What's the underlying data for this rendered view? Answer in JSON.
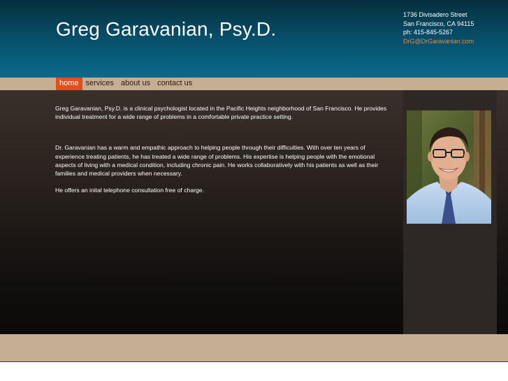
{
  "header": {
    "title": "Greg Garavanian, Psy.D.",
    "contact": {
      "street": "1736 Divisadero Street",
      "city": "San Francisco, CA 94115",
      "phone": "ph: 415-845-5267",
      "email": "DrG@DrGaravanian.com"
    }
  },
  "nav": {
    "items": [
      {
        "label": "home",
        "active": true
      },
      {
        "label": "services",
        "active": false
      },
      {
        "label": "about us",
        "active": false
      },
      {
        "label": "contact us",
        "active": false
      }
    ]
  },
  "main": {
    "paragraphs": [
      "Greg Garavanian, Psy.D. is a clinical psychologist located in the Pacific Heights neighborhood of San Francisco.  He provides individual treatment for a wide range of problems in a comfortable private practice setting.",
      "Dr. Garavanian has a warm and empathic approach to helping people through their difficulties.  With over ten years of experience treating patients, he has treated a wide range of problems.  His expertise is helping people with the emotional aspects of living with a medical condition, including chronic pain.  He works collaboratively with his patients as well as their families and medical providers when necessary.",
      "He offers an inital telephone consultation free of charge."
    ]
  },
  "colors": {
    "header_top": "#062e3c",
    "header_bottom": "#0a6a8c",
    "nav_bg": "#c6ae93",
    "nav_active": "#e1501c",
    "email_link": "#e58a3a",
    "sidebar_bg": "#2d2826"
  }
}
